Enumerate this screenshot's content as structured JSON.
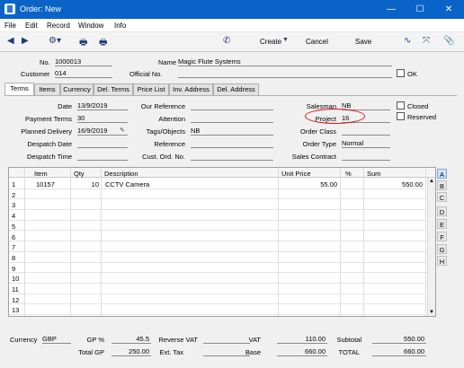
{
  "window": {
    "title": "Order: New"
  },
  "menu": [
    "File",
    "Edit",
    "Record",
    "Window",
    "Info"
  ],
  "toolbar": {
    "create": "Create",
    "cancel": "Cancel",
    "save": "Save"
  },
  "header": {
    "no_label": "No.",
    "no_value": "1000013",
    "name_label": "Name",
    "name_value": "Magic Flute Systems",
    "customer_label": "Customer",
    "customer_value": "014",
    "official_label": "Official No.",
    "official_value": "",
    "ok_label": "OK"
  },
  "tabs": [
    "Terms",
    "Items",
    "Currency",
    "Del. Terms",
    "Price List",
    "Inv. Address",
    "Del. Address"
  ],
  "terms": {
    "date_label": "Date",
    "date_value": "13/9/2019",
    "payterms_label": "Payment Terms",
    "payterms_value": "30",
    "planned_label": "Planned Delivery",
    "planned_value": "16/9/2019",
    "despdate_label": "Despatch Date",
    "despdate_value": "",
    "desptime_label": "Despatch Time",
    "desptime_value": "",
    "ourref_label": "Our Reference",
    "ourref_value": "",
    "attention_label": "Attention",
    "attention_value": "",
    "tags_label": "Tags/Objects",
    "tags_value": "NB",
    "reference_label": "Reference",
    "reference_value": "",
    "custord_label": "Cust. Ord. No.",
    "custord_value": "",
    "salesman_label": "Salesman",
    "salesman_value": "NB",
    "project_label": "Project",
    "project_value": "16",
    "orderclass_label": "Order Class",
    "orderclass_value": "",
    "ordertype_label": "Order Type",
    "ordertype_value": "Normal",
    "salescontract_label": "Sales Contract",
    "salescontract_value": "",
    "closed_label": "Closed",
    "reserved_label": "Reserved"
  },
  "grid": {
    "columns": [
      "Item",
      "Qty",
      "Description",
      "Unit Price",
      "%",
      "Sum"
    ],
    "rows": [
      {
        "n": "1",
        "item": "10157",
        "qty": "10",
        "desc": "CCTV Camera",
        "price": "55.00",
        "pct": "",
        "sum": "550.00"
      },
      {
        "n": "2"
      },
      {
        "n": "3"
      },
      {
        "n": "4"
      },
      {
        "n": "5"
      },
      {
        "n": "6"
      },
      {
        "n": "7"
      },
      {
        "n": "8"
      },
      {
        "n": "9"
      },
      {
        "n": "10"
      },
      {
        "n": "11"
      },
      {
        "n": "12"
      },
      {
        "n": "13"
      }
    ],
    "side_tabs": [
      "A",
      "B",
      "C",
      "D",
      "E",
      "F",
      "G",
      "H"
    ]
  },
  "footer": {
    "currency_label": "Currency",
    "currency_value": "GBP",
    "gp_label": "GP %",
    "gp_value": "45.5",
    "reversevat_label": "Reverse VAT",
    "reversevat_value": "",
    "vat_label": "VAT",
    "vat_value": "110.00",
    "subtotal_label": "Subtotal",
    "subtotal_value": "550.00",
    "totalgp_label": "Total GP",
    "totalgp_value": "250.00",
    "exttax_label": "Ext. Tax",
    "exttax_value": "",
    "base_label": "Base",
    "base_value": "660.00",
    "total_label": "TOTAL",
    "total_value": "660.00"
  },
  "colors": {
    "titlebar": "#0a64c8",
    "highlight_oval": "#e01010"
  }
}
